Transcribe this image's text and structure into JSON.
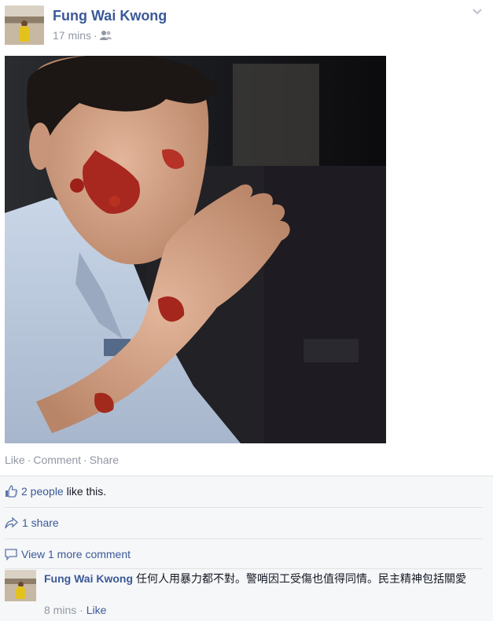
{
  "post": {
    "author": "Fung Wai Kwong",
    "time": "17 mins",
    "audience_icon": "friends-icon",
    "menu_icon": "chevron-down-icon"
  },
  "photo": {
    "alt": "Photo"
  },
  "actions": {
    "like": "Like",
    "comment": "Comment",
    "share": "Share"
  },
  "ufi": {
    "likes_count": "2 people",
    "likes_suffix": "like this.",
    "shares": "1 share",
    "view_more": "View 1 more comment"
  },
  "comment": {
    "author": "Fung Wai Kwong",
    "text": "任何人用暴力都不對。警哨因工受傷也值得同情。民主精神包括關愛",
    "time": "8 mins",
    "like": "Like"
  },
  "colors": {
    "link": "#3b5998",
    "muted": "#9197a3",
    "ufi_bg": "#f6f7f8"
  }
}
